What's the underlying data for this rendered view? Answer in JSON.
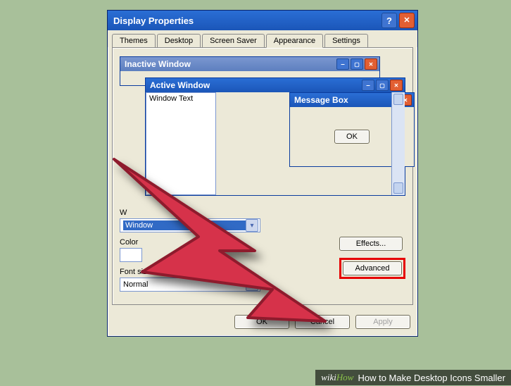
{
  "titlebar": {
    "title": "Display Properties",
    "help": "?",
    "close": "✕"
  },
  "tabs": [
    {
      "label": "Themes"
    },
    {
      "label": "Desktop"
    },
    {
      "label": "Screen Saver"
    },
    {
      "label": "Appearance"
    },
    {
      "label": "Settings"
    }
  ],
  "active_tab": 3,
  "preview": {
    "inactive_window_title": "Inactive Window",
    "active_window_title": "Active Window",
    "window_text": "Window Text",
    "message_box_title": "Message Box",
    "msgbox_ok": "OK"
  },
  "form": {
    "windows_and_buttons": {
      "label": "Windows and buttons:",
      "short_label_visible": "W",
      "value": "Windows XP style",
      "value_visible_part": "Window"
    },
    "color_scheme": {
      "label": "Color scheme:",
      "short_label_visible": "Color"
    },
    "font_size": {
      "label": "Font size:",
      "value": "Normal"
    }
  },
  "buttons": {
    "effects": "Effects...",
    "advanced": "Advanced",
    "ok": "OK",
    "cancel": "Cancel",
    "apply": "Apply"
  },
  "caption": {
    "brand_wiki": "wiki",
    "brand_how": "How",
    "article_title": "How to Make Desktop Icons Smaller"
  }
}
